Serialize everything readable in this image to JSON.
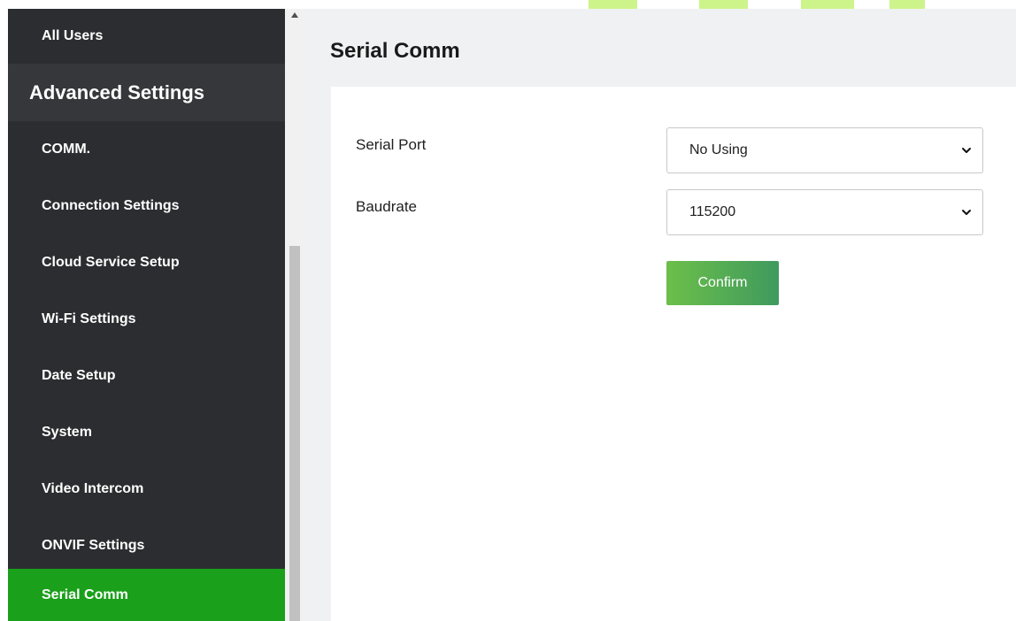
{
  "sidebar": {
    "items_top": [
      {
        "label": "All Users"
      }
    ],
    "group": {
      "label": "Advanced Settings"
    },
    "items": [
      {
        "label": "COMM."
      },
      {
        "label": "Connection Settings"
      },
      {
        "label": "Cloud Service Setup"
      },
      {
        "label": "Wi-Fi Settings"
      },
      {
        "label": "Date Setup"
      },
      {
        "label": "System"
      },
      {
        "label": "Video Intercom"
      },
      {
        "label": "ONVIF Settings"
      },
      {
        "label": "Serial Comm",
        "active": true
      }
    ]
  },
  "main": {
    "title": "Serial Comm",
    "form": {
      "serial_port": {
        "label": "Serial Port",
        "value": "No Using"
      },
      "baudrate": {
        "label": "Baudrate",
        "value": "115200"
      },
      "confirm_label": "Confirm"
    }
  },
  "colors": {
    "sidebar_bg": "#2b2d30",
    "active_item": "#1aa01a",
    "confirm_start": "#6cbf4a",
    "confirm_end": "#3f9a5e",
    "main_bg": "#f0f1f2"
  },
  "icons": {
    "scroll_up": "triangle-up-icon",
    "dropdown": "chevron-down-icon"
  }
}
